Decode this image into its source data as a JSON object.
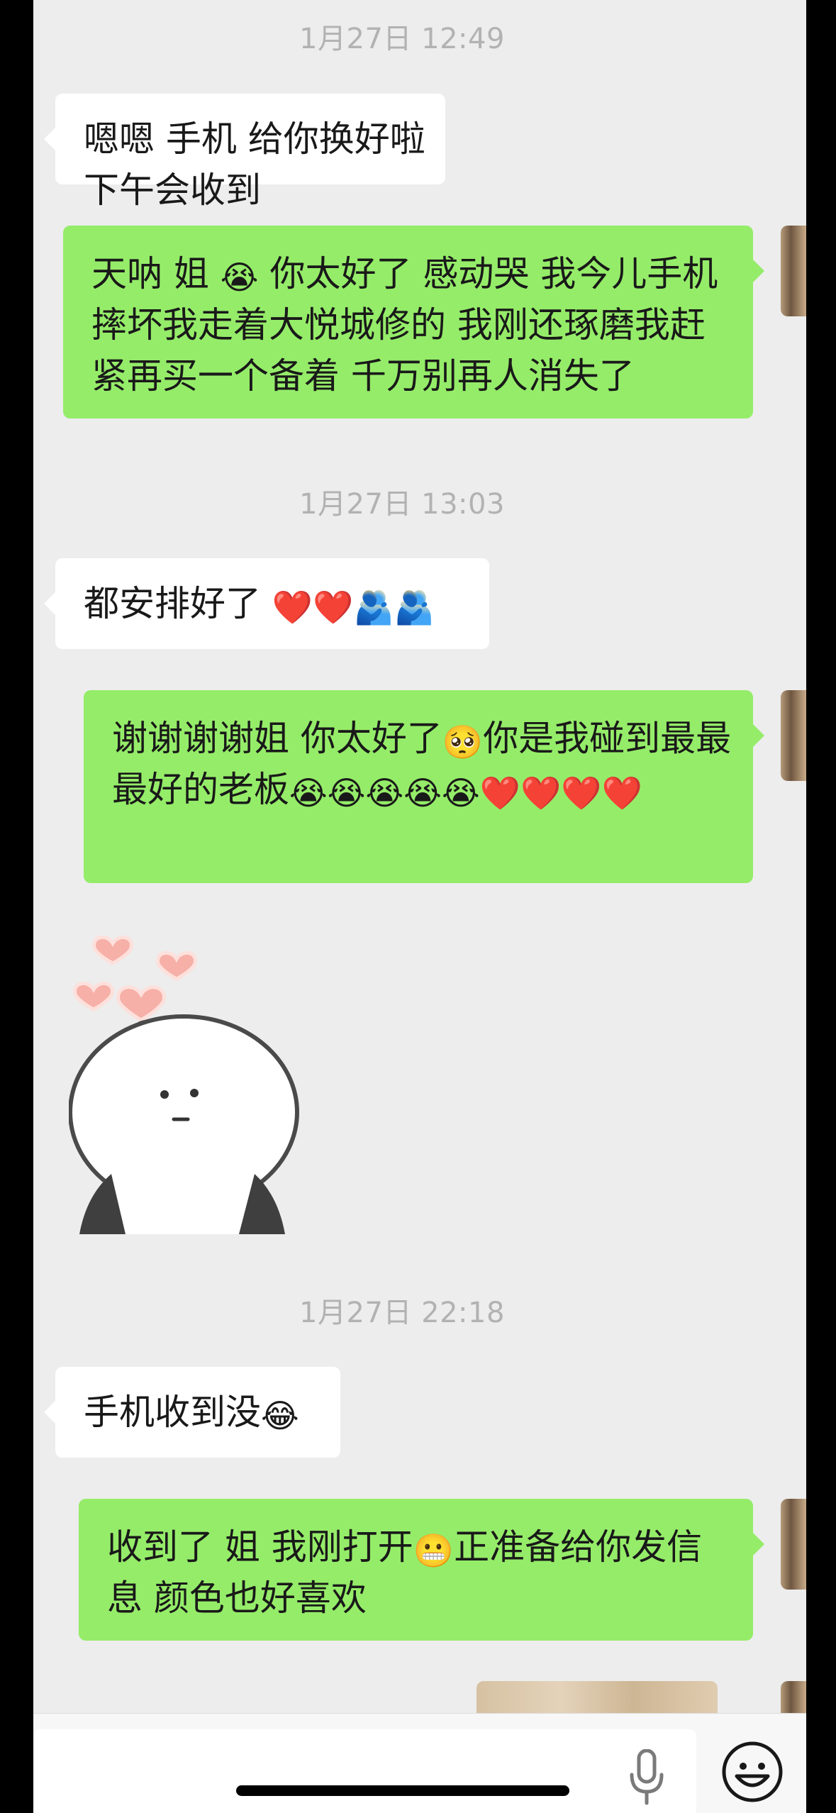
{
  "timestamps": [
    "1月27日 12:49",
    "1月27日 13:03",
    "1月27日 22:18"
  ],
  "messages": {
    "m1": "嗯嗯 手机 给你换好啦  下午会收到",
    "m2_a": "天呐 姐 ",
    "m2_b": " 你太好了 感动哭  我今儿手机摔坏我走着大悦城修的 我刚还琢磨我赶紧再买一个备着 千万别再人消失了",
    "m3": "都安排好了 ",
    "m4_a": "谢谢谢谢姐 你太好了",
    "m4_b": "你是我碰到最最最好的老板",
    "m5": "手机收到没",
    "m6_a": "收到了 姐 我刚打开",
    "m6_b": "正准备给你发信息 颜色也好喜欢"
  },
  "emoji": {
    "crying": "😭",
    "heart": "❤️",
    "hug": "🫂",
    "pleading": "🥺",
    "tears_of_joy": "😂",
    "grimace": "😬"
  },
  "icons": {
    "mic": "microphone-icon",
    "emoji_button": "smiley-face-icon",
    "sticker": "panda-sticker"
  },
  "colors": {
    "background": "#ededed",
    "incoming_bubble": "#ffffff",
    "outgoing_bubble": "#95ec69",
    "timestamp": "#b2b2b2"
  }
}
